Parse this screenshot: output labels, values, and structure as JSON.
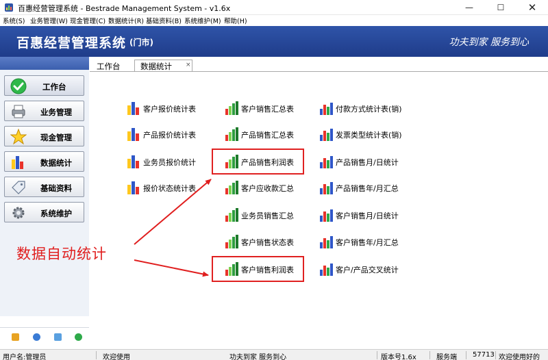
{
  "window": {
    "title": "百惠经营管理系统 - Bestrade Management System - v1.6x",
    "controls": [
      "minimize-icon",
      "maximize-icon",
      "close-icon"
    ]
  },
  "menu": {
    "items": [
      "系统(S)",
      "业务管理(W)",
      "现金管理(C)",
      "数据统计(R)",
      "基础资料(B)",
      "系统维护(M)",
      "帮助(H)"
    ]
  },
  "banner": {
    "title": "百惠经营管理系统",
    "subtitle": "(门市)",
    "slogan": "功夫到家  服务到心"
  },
  "sidebar": {
    "items": [
      {
        "label": "工作台",
        "icon": "check-icon"
      },
      {
        "label": "业务管理",
        "icon": "printer-icon"
      },
      {
        "label": "现金管理",
        "icon": "star-icon"
      },
      {
        "label": "数据统计",
        "icon": "bar-chart-icon"
      },
      {
        "label": "基础资料",
        "icon": "tag-icon"
      },
      {
        "label": "系统维护",
        "icon": "gear-icon"
      }
    ],
    "footer_icons": [
      "key-icon",
      "info-icon",
      "search-icon",
      "exit-icon"
    ]
  },
  "tabs": {
    "workbench": "工作台",
    "stats": "数据统计",
    "close": "×"
  },
  "reports": {
    "col1": [
      "客户报价统计表",
      "产品报价统计表",
      "业务员报价统计",
      "报价状态统计表"
    ],
    "col2": [
      "客户销售汇总表",
      "产品销售汇总表",
      "产品销售利润表",
      "客户应收款汇总",
      "业务员销售汇总",
      "客户销售状态表",
      "客户销售利润表"
    ],
    "col3": [
      "付款方式统计表(销)",
      "发票类型统计表(销)",
      "产品销售月/日统计",
      "产品销售年/月汇总",
      "客户销售月/日统计",
      "客户销售年/月汇总",
      "客户/产品交叉统计"
    ]
  },
  "annotation": {
    "text": "数据自动统计",
    "color": "#e01e1e"
  },
  "status": {
    "user": "用户名:管理员",
    "welcome": "欢迎使用",
    "slogan": "功夫到家 服务到心",
    "version": "版本号1.6x",
    "server_label": "服务端",
    "server_port": "57713",
    "greeting": "欢迎使用好的"
  },
  "colors": {
    "banner": "#2f54a8",
    "highlight": "#e02020"
  }
}
